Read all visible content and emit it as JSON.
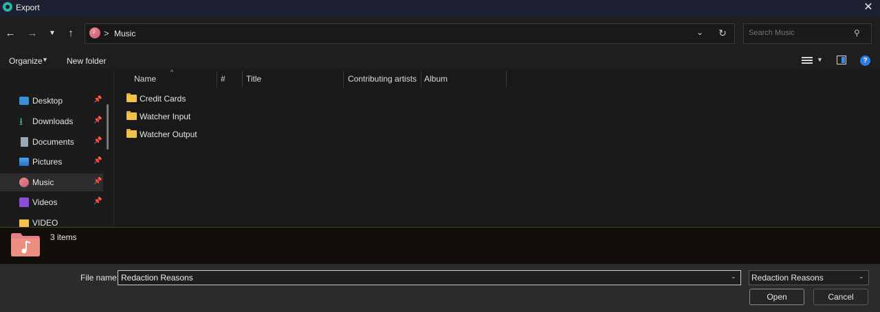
{
  "window": {
    "title": "Export"
  },
  "nav": {
    "breadcrumb": [
      "Music"
    ],
    "breadcrumb_sep": ">",
    "search_placeholder": "Search Music"
  },
  "commands": {
    "organize": "Organize",
    "new_folder": "New folder"
  },
  "sidebar": {
    "items": [
      {
        "label": "Desktop",
        "icon": "desktop-icon",
        "pinned": true
      },
      {
        "label": "Downloads",
        "icon": "downloads-icon",
        "pinned": true
      },
      {
        "label": "Documents",
        "icon": "documents-icon",
        "pinned": true
      },
      {
        "label": "Pictures",
        "icon": "pictures-icon",
        "pinned": true
      },
      {
        "label": "Music",
        "icon": "music-icon",
        "pinned": true,
        "selected": true
      },
      {
        "label": "Videos",
        "icon": "videos-icon",
        "pinned": true
      },
      {
        "label": "VIDEO",
        "icon": "folder-icon",
        "pinned": false
      }
    ]
  },
  "columns": [
    "Name",
    "#",
    "Title",
    "Contributing artists",
    "Album"
  ],
  "files": [
    {
      "name": "Credit Cards",
      "type": "folder"
    },
    {
      "name": "Watcher Input",
      "type": "folder"
    },
    {
      "name": "Watcher Output",
      "type": "folder"
    }
  ],
  "details": {
    "items_count": "3 items"
  },
  "bottom": {
    "file_name_label": "File name:",
    "file_name_value": "Redaction Reasons",
    "file_type": "Redaction Reasons",
    "open_label": "Open",
    "cancel_label": "Cancel"
  },
  "colors": {
    "accent": "#2b7de0",
    "folder": "#f1c24b",
    "music": "#e57b8b"
  }
}
